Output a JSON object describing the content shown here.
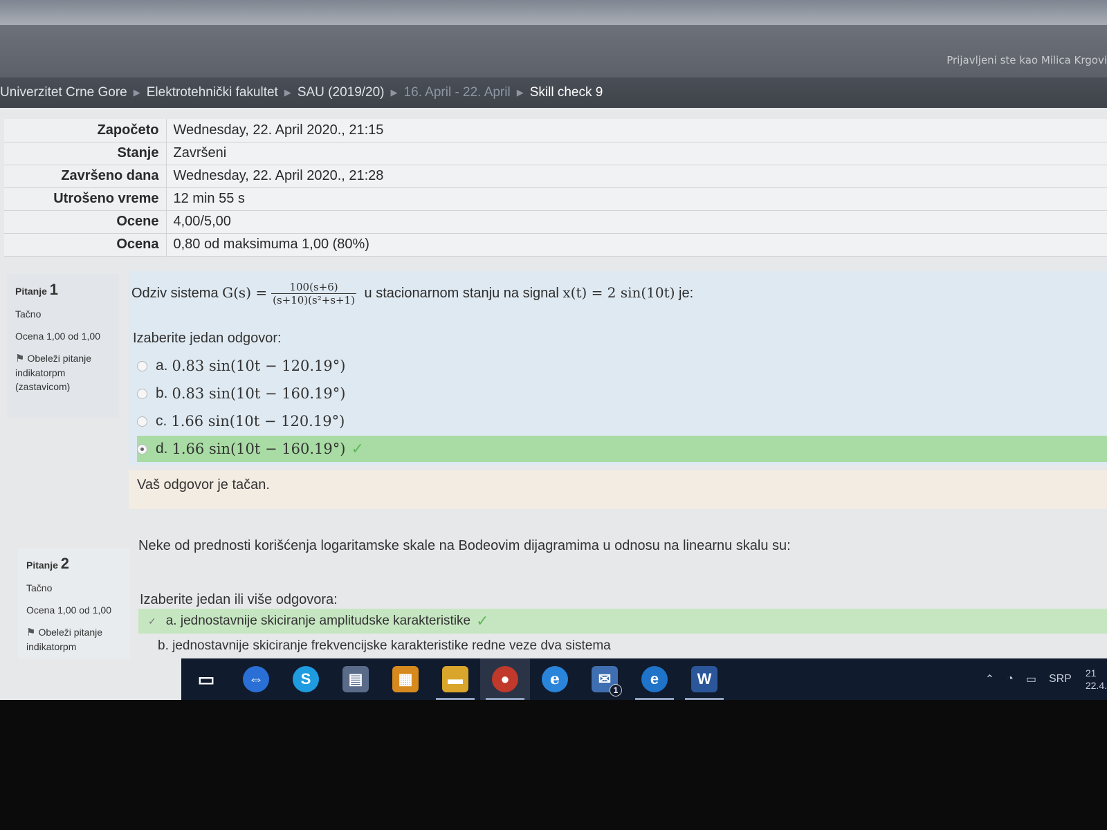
{
  "header": {
    "login_text": "Prijavljeni ste kao Milica Krgovi"
  },
  "breadcrumb": [
    {
      "label": "Univerzitet Crne Gore",
      "muted": false
    },
    {
      "label": "Elektrotehnički fakultet",
      "muted": false
    },
    {
      "label": "SAU (2019/20)",
      "muted": false
    },
    {
      "label": "16. April - 22. April",
      "muted": true
    },
    {
      "label": "Skill check 9",
      "muted": false
    }
  ],
  "summary": [
    {
      "label": "Započeto",
      "value": "Wednesday, 22. April 2020., 21:15"
    },
    {
      "label": "Stanje",
      "value": "Završeni"
    },
    {
      "label": "Završeno dana",
      "value": "Wednesday, 22. April 2020., 21:28"
    },
    {
      "label": "Utrošeno vreme",
      "value": "12 min 55 s"
    },
    {
      "label": "Ocene",
      "value": "4,00/5,00"
    },
    {
      "label": "Ocena",
      "value": "0,80 od maksimuma 1,00 (80%)"
    }
  ],
  "q1": {
    "label": "Pitanje",
    "number": "1",
    "status": "Tačno",
    "grade": "Ocena 1,00 od 1,00",
    "flag_text": "Obeleži pitanje indikatorpm (zastavicom)",
    "text_before": "Odziv sistema ",
    "gs": "G(s) =",
    "numerator": "100(s+6)",
    "denominator": "(s+10)(s²+s+1)",
    "text_after": " u stacionarnom stanju na signal ",
    "signal": "x(t) = 2 sin(10t)",
    "text_end": " je:",
    "prompt": "Izaberite jedan odgovor:",
    "options": [
      {
        "letter": "a.",
        "text": "0.83 sin(10t − 120.19°)",
        "checked": false,
        "correct": false
      },
      {
        "letter": "b.",
        "text": "0.83 sin(10t − 160.19°)",
        "checked": false,
        "correct": false
      },
      {
        "letter": "c.",
        "text": "1.66 sin(10t − 120.19°)",
        "checked": false,
        "correct": false
      },
      {
        "letter": "d.",
        "text": "1.66 sin(10t − 160.19°)",
        "checked": true,
        "correct": true
      }
    ],
    "feedback": "Vaš odgovor je tačan."
  },
  "q2": {
    "label": "Pitanje",
    "number": "2",
    "status": "Tačno",
    "grade": "Ocena 1,00 od 1,00",
    "flag_text": "Obeleži pitanje indikatorpm",
    "text": "Neke od prednosti korišćenja logaritamske skale na Bodeovim dijagramima u odnosu na linearnu skalu su:",
    "prompt": "Izaberite jedan ili više odgovora:",
    "options": [
      {
        "text": "a. jednostavnije skiciranje amplitudske karakteristike",
        "checked": true,
        "correct": true
      },
      {
        "text": "b. jednostavnije skiciranje frekvencijske karakteristike redne veze dva sistema",
        "checked": false,
        "correct": false
      }
    ]
  },
  "taskbar": {
    "icons": [
      {
        "name": "task-view-icon",
        "glyph": "▭",
        "color": "#101b2e"
      },
      {
        "name": "teamviewer-icon",
        "glyph": "⇔",
        "color": "#2a6fd6"
      },
      {
        "name": "skype-icon",
        "glyph": "S",
        "color": "#1f9be0"
      },
      {
        "name": "calendar-app-icon",
        "glyph": "▤",
        "color": "#5a6b8a"
      },
      {
        "name": "store-icon",
        "glyph": "▦",
        "color": "#d68a1e"
      },
      {
        "name": "file-explorer-icon",
        "glyph": "▬",
        "color": "#d9a52a"
      },
      {
        "name": "chrome-icon",
        "glyph": "●",
        "color": "#c0392b"
      },
      {
        "name": "internet-explorer-icon",
        "glyph": "e",
        "color": "#2a84d9"
      },
      {
        "name": "mail-icon",
        "glyph": "✉",
        "color": "#3f6fb0"
      },
      {
        "name": "edge-icon",
        "glyph": "e",
        "color": "#1f73c9"
      },
      {
        "name": "word-icon",
        "glyph": "W",
        "color": "#2b579a"
      }
    ],
    "mail_badge": "1",
    "lang": "SRP",
    "clock_time": "21",
    "clock_date": "22.4."
  }
}
